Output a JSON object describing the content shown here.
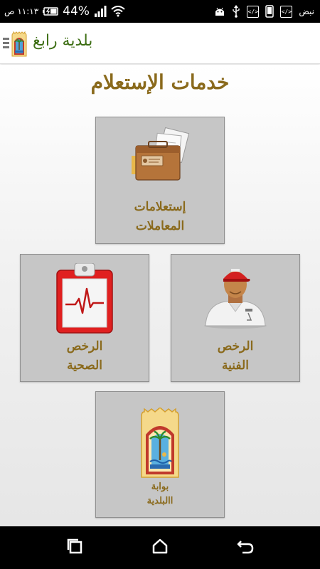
{
  "status_bar": {
    "time": "١١:١٣ ص",
    "battery": "44%",
    "carrier": "نبض",
    "icons": [
      "clock-icon",
      "battery-icon",
      "signal-icon",
      "wifi-icon",
      "android-icon",
      "usb-icon",
      "code-icon",
      "phone-icon",
      "code-icon"
    ]
  },
  "app_bar": {
    "title": "بلدية رابغ"
  },
  "main": {
    "section_title": "خدمات الإستعلام",
    "tiles": [
      {
        "id": "inquiries",
        "icon": "briefcase-icon",
        "line1": "إستعلامات",
        "line2": "المعاملات"
      },
      {
        "id": "technical",
        "icon": "worker-icon",
        "line1": "الرخص",
        "line2": "الفنية"
      },
      {
        "id": "health",
        "icon": "medical-clipboard-icon",
        "line1": "الرخص",
        "line2": "الصحية"
      },
      {
        "id": "portal",
        "icon": "municipality-emblem-icon",
        "line1": "بوابة",
        "line2": "االبلدية"
      }
    ]
  },
  "nav_bar": {
    "icons": [
      "recent-apps-icon",
      "home-icon",
      "back-icon"
    ]
  },
  "colors": {
    "title_brown": "#8a6a1c",
    "app_title_green": "#3d6e14",
    "tile_bg": "#c6c6c6"
  }
}
